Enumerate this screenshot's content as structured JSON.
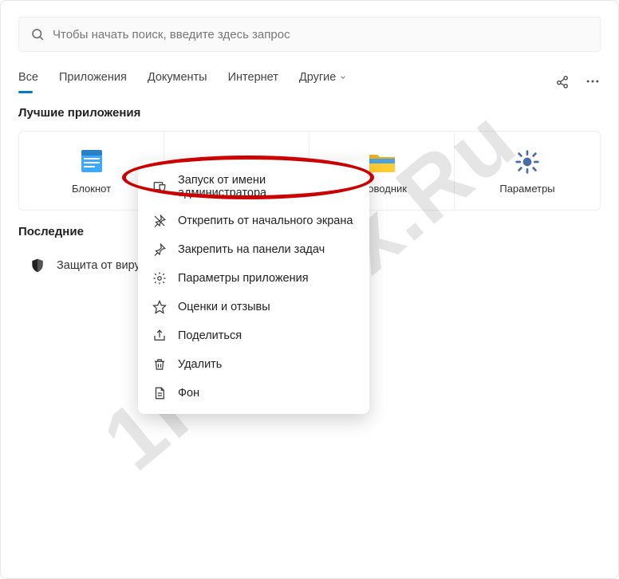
{
  "search": {
    "placeholder": "Чтобы начать поиск, введите здесь запрос"
  },
  "tabs": {
    "all": "Все",
    "apps": "Приложения",
    "docs": "Документы",
    "web": "Интернет",
    "more": "Другие"
  },
  "sections": {
    "best_apps": "Лучшие приложения",
    "recent": "Последние"
  },
  "apps": [
    {
      "label": "Блокнот"
    },
    {
      "label": ""
    },
    {
      "label": "проводник"
    },
    {
      "label": "Параметры"
    }
  ],
  "recent_items": [
    {
      "label": "Защита от виру"
    }
  ],
  "context_menu": [
    {
      "label": "Запуск от имени администратора"
    },
    {
      "label": "Открепить от начального экрана"
    },
    {
      "label": "Закрепить на панели задач"
    },
    {
      "label": "Параметры приложения"
    },
    {
      "label": "Оценки и отзывы"
    },
    {
      "label": "Поделиться"
    },
    {
      "label": "Удалить"
    },
    {
      "label": "Фон"
    }
  ],
  "watermark": "1Roblox.Ru"
}
